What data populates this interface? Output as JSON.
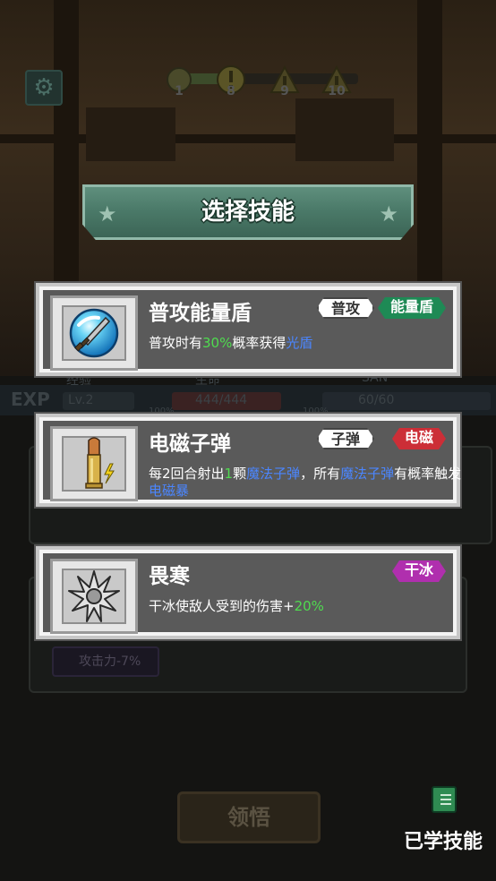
{
  "hud": {
    "stages": [
      "1",
      "8",
      "9",
      "10"
    ],
    "stats": {
      "exp_label": "EXP",
      "exp_heading": "经验",
      "level": "Lv.2",
      "hp_heading": "生命",
      "hp": "444/444",
      "hp_pct": "100%",
      "san_heading": "SAN",
      "san": "60/60",
      "san_pct": "100%"
    }
  },
  "dialog": {
    "title": "选择技能"
  },
  "skills": [
    {
      "name": "普攻能量盾",
      "icon": "energy-shield-sword-icon",
      "tags": [
        {
          "label": "普攻",
          "style": "white"
        },
        {
          "label": "能量盾",
          "style": "green"
        }
      ],
      "desc": [
        {
          "t": "普攻时有"
        },
        {
          "t": "30%",
          "c": "green"
        },
        {
          "t": "概率获得"
        },
        {
          "t": "光盾",
          "c": "blue"
        }
      ]
    },
    {
      "name": "电磁子弹",
      "icon": "bullet-icon",
      "tags": [
        {
          "label": "子弹",
          "style": "white"
        },
        {
          "label": "电磁",
          "style": "red"
        }
      ],
      "desc": [
        {
          "t": "每2回合射出"
        },
        {
          "t": "1",
          "c": "green"
        },
        {
          "t": "颗"
        },
        {
          "t": "魔法子弹",
          "c": "blue"
        },
        {
          "t": "，所有"
        },
        {
          "t": "魔法子弹",
          "c": "blue"
        },
        {
          "t": "有概率触发"
        },
        {
          "t": "电磁暴",
          "c": "blue"
        }
      ]
    },
    {
      "name": "畏寒",
      "icon": "frost-spike-icon",
      "tags": [
        {
          "label": "干冰",
          "style": "purple"
        }
      ],
      "desc": [
        {
          "t": "干冰使敌人受到的伤害+"
        },
        {
          "t": "20%",
          "c": "green"
        }
      ]
    }
  ],
  "background": {
    "attack_tag": "攻击力-7%",
    "learn_button": "领悟"
  },
  "learned": {
    "label": "已学技能",
    "icon": "notebook-icon"
  }
}
